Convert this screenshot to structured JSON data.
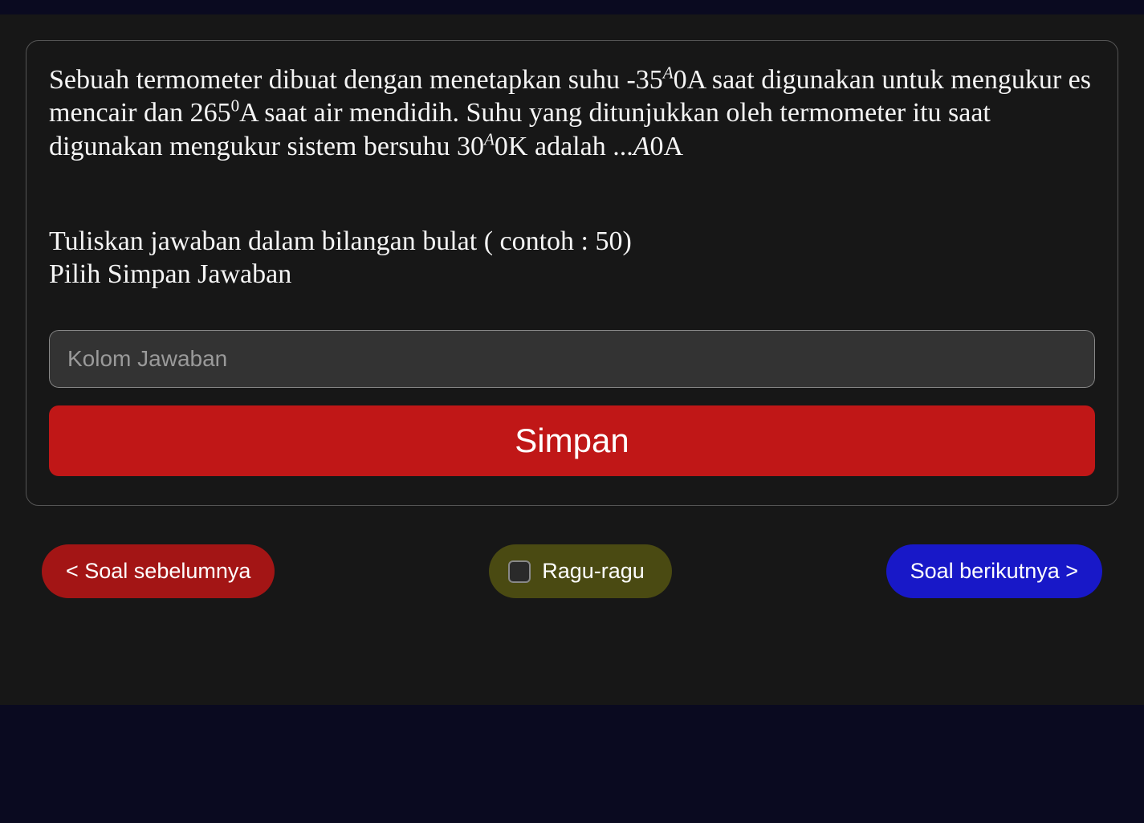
{
  "question": {
    "p1a": "Sebuah termometer dibuat dengan menetapkan suhu -35",
    "p1_sup1": "A",
    "p1b": "0A saat digunakan untuk mengukur es mencair dan 265",
    "p1_sup2": "0",
    "p1c": "A saat air mendidih. Suhu yang ditunjukkan oleh termometer itu saat digunakan mengukur sistem bersuhu 30",
    "p1_sup3": "A",
    "p1d": "0K adalah ...",
    "p1_tail_ital": "A",
    "p1_tail": "0A"
  },
  "instructions": {
    "line1": "Tuliskan jawaban dalam bilangan bulat ( contoh : 50)",
    "line2": "Pilih Simpan Jawaban"
  },
  "input": {
    "placeholder": "Kolom Jawaban",
    "value": ""
  },
  "buttons": {
    "save": "Simpan",
    "prev": "< Soal sebelumnya",
    "doubt": "Ragu-ragu",
    "next": "Soal berikutnya >"
  }
}
